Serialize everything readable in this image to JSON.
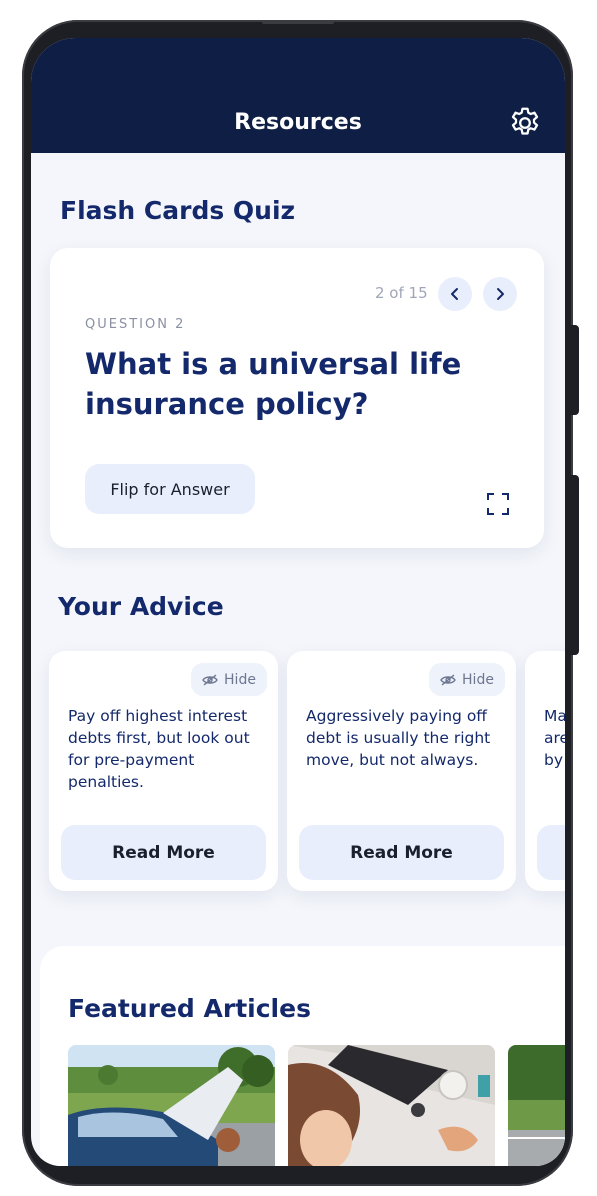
{
  "header": {
    "title": "Resources",
    "settings_icon": "gear-icon"
  },
  "quiz": {
    "section_title": "Flash Cards Quiz",
    "counter": "2 of 15",
    "question_label": "QUESTION 2",
    "question": "What is a universal life insurance policy?",
    "flip_label": "Flip for Answer",
    "icons": [
      "chevron-left-icon",
      "chevron-right-icon",
      "expand-icon"
    ]
  },
  "advice": {
    "section_title": "Your Advice",
    "hide_label": "Hide",
    "read_more_label": "Read More",
    "cards": [
      {
        "text": "Pay off highest interest debts first, but look out for pre-payment penalties."
      },
      {
        "text": "Aggressively paying off debt is usually the right move, but not always."
      },
      {
        "text": "Ma are by"
      }
    ]
  },
  "featured": {
    "section_title": "Featured Articles"
  },
  "colors": {
    "navy": "#0e1e45",
    "title_blue": "#14296b",
    "chip_bg": "#e8eefc",
    "screen_bg": "#f4f6fb"
  }
}
